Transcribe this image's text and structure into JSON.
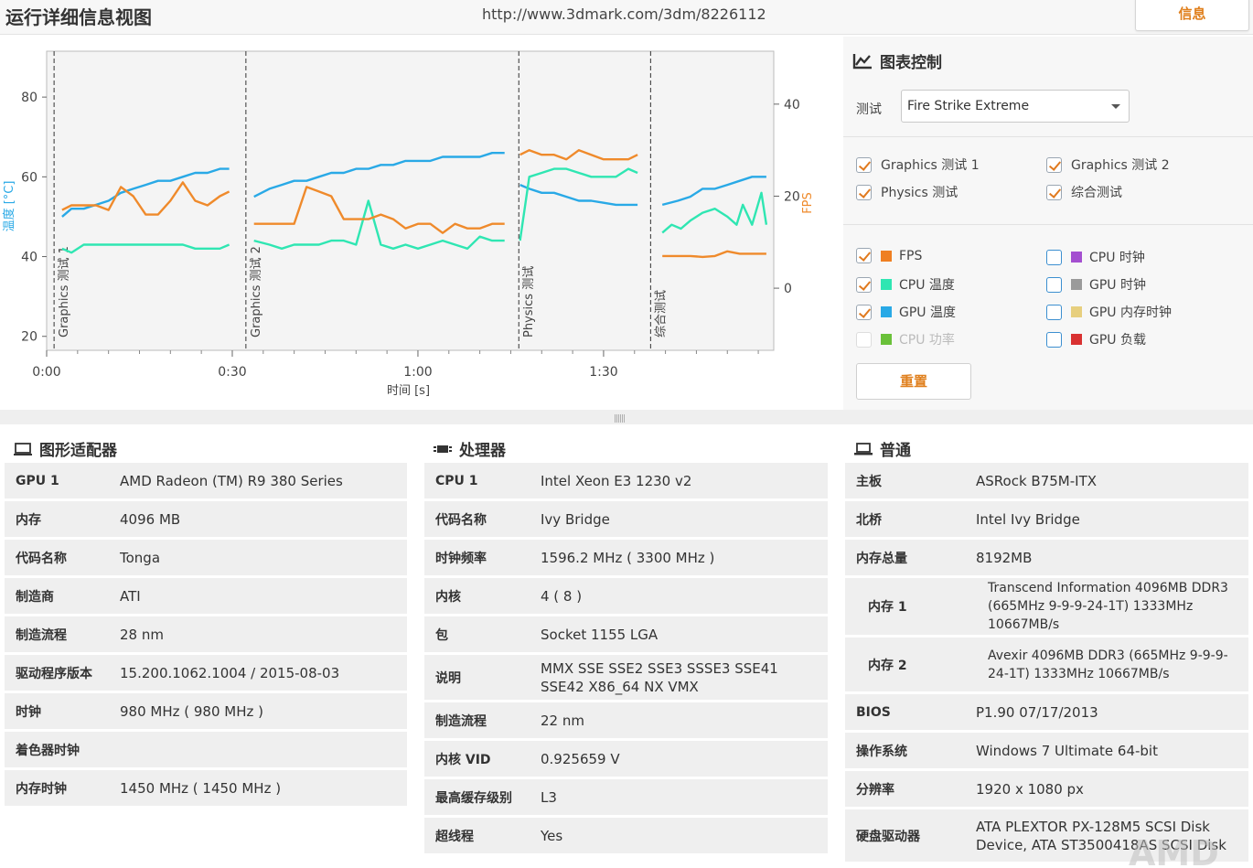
{
  "header": {
    "title": "运行详细信息视图",
    "url": "http://www.3dmark.com/3dm/8226112",
    "info_button": "信息"
  },
  "chart_data": {
    "type": "line",
    "xlabel": "时间 [s]",
    "ylabel_left": "温度 [°C]",
    "ylabel_right": "FPS",
    "x_ticks": [
      "0:00",
      "0:30",
      "1:00",
      "1:30"
    ],
    "x_tick_values": [
      0,
      30,
      60,
      90
    ],
    "y_left_ticks": [
      "20",
      "40",
      "60",
      "80"
    ],
    "y_left_tick_values": [
      20,
      40,
      60,
      80
    ],
    "y_right_ticks": [
      "0",
      "20",
      "40"
    ],
    "y_right_tick_values": [
      0,
      20,
      40
    ],
    "xlim": [
      0,
      117.5
    ],
    "ylim_left": [
      16.5,
      91.5
    ],
    "ylim_right": [
      -13.5,
      51.5
    ],
    "grid": false,
    "sections": [
      {
        "label": "Graphics 测试 1",
        "start": 1.2
      },
      {
        "label": "Graphics 测试 2",
        "start": 32.2
      },
      {
        "label": "Physics 测试",
        "start": 76.3
      },
      {
        "label": "综合测试",
        "start": 97.6
      }
    ],
    "series": [
      {
        "name": "GPU 温度",
        "axis": "left",
        "color": "#29a9e6",
        "segments": [
          {
            "x": [
              2.5,
              4,
              6,
              8,
              10,
              12,
              14,
              16,
              18,
              20,
              22,
              24,
              26,
              28,
              29.5
            ],
            "y": [
              50,
              52,
              52,
              53,
              54,
              56,
              57,
              58,
              59,
              59,
              60,
              61,
              61,
              62,
              62
            ]
          },
          {
            "x": [
              33.5,
              36,
              38,
              40,
              42,
              44,
              46,
              48,
              50,
              52,
              54,
              56,
              58,
              60,
              62,
              64,
              66,
              68,
              70,
              72,
              74
            ],
            "y": [
              55,
              57,
              58,
              59,
              59,
              60,
              61,
              61,
              62,
              62,
              63,
              63,
              64,
              64,
              64,
              65,
              65,
              65,
              65,
              66,
              66
            ]
          },
          {
            "x": [
              76.5,
              78,
              80,
              82,
              84,
              86,
              88,
              90,
              92,
              94,
              95.5
            ],
            "y": [
              58,
              57,
              56,
              56,
              55,
              54,
              54,
              53.5,
              53,
              53,
              53
            ]
          },
          {
            "x": [
              99.5,
              102,
              104,
              106,
              108,
              110,
              112,
              114,
              116.3
            ],
            "y": [
              53,
              54,
              55,
              57,
              57,
              58,
              59,
              60,
              60
            ]
          }
        ]
      },
      {
        "name": "CPU 温度",
        "axis": "left",
        "color": "#2fe6b2",
        "segments": [
          {
            "x": [
              2.5,
              4,
              6,
              8,
              10,
              12,
              14,
              16,
              18,
              20,
              22,
              24,
              26,
              28,
              29.5
            ],
            "y": [
              42,
              41,
              43,
              43,
              43,
              43,
              43,
              43,
              43,
              43,
              43,
              42,
              42,
              42,
              43
            ]
          },
          {
            "x": [
              33.5,
              36,
              38,
              40,
              42,
              44,
              46,
              48,
              50,
              52,
              54,
              56,
              58,
              60,
              62,
              64,
              66,
              68,
              70,
              72,
              74
            ],
            "y": [
              44,
              43,
              42,
              43,
              43,
              43,
              44,
              44,
              43,
              54,
              43,
              42,
              43,
              42,
              43,
              44,
              43,
              42,
              45,
              44,
              44
            ]
          },
          {
            "x": [
              76.5,
              78,
              80,
              82,
              84,
              86,
              88,
              90,
              92,
              94,
              95.5
            ],
            "y": [
              44,
              60,
              61,
              62,
              62,
              61,
              60,
              60,
              60,
              62,
              61
            ]
          },
          {
            "x": [
              99.5,
              101,
              102.5,
              104,
              106,
              108,
              110,
              111.5,
              112.5,
              114,
              115.5,
              116.3
            ],
            "y": [
              46,
              48,
              47,
              49,
              51,
              52,
              50,
              48,
              53,
              48,
              56,
              48
            ]
          }
        ]
      },
      {
        "name": "FPS",
        "axis": "right",
        "color": "#ef8a2b",
        "segments": [
          {
            "x": [
              2.5,
              4,
              6,
              8,
              10,
              12,
              14,
              16,
              18,
              20,
              22,
              24,
              26,
              28,
              29.5
            ],
            "y": [
              17,
              18,
              18,
              18,
              17,
              22,
              20,
              16,
              16,
              19,
              23,
              19,
              18,
              20,
              21
            ]
          },
          {
            "x": [
              33.5,
              36,
              38,
              40,
              42,
              44,
              46,
              48,
              50,
              52,
              54,
              56,
              58,
              60,
              62,
              64,
              66,
              68,
              70,
              72,
              74
            ],
            "y": [
              14,
              14,
              14,
              14,
              22,
              21,
              20,
              15,
              15,
              15,
              16,
              15,
              13,
              14,
              14,
              12,
              14,
              13,
              13,
              14,
              14
            ]
          },
          {
            "x": [
              76.5,
              78,
              80,
              82,
              84,
              86,
              88,
              90,
              92,
              94,
              95.5
            ],
            "y": [
              29,
              30,
              29,
              29,
              28,
              30,
              29,
              28,
              28,
              28,
              29
            ]
          },
          {
            "x": [
              99.5,
              102,
              104,
              106,
              108,
              110,
              112,
              114,
              116.3
            ],
            "y": [
              7,
              7,
              7,
              6.8,
              7,
              8,
              7.5,
              7.5,
              7.5
            ]
          }
        ]
      }
    ]
  },
  "chart_control": {
    "title": "图表控制",
    "test_label": "测试",
    "test_selected": "Fire Strike Extreme",
    "tests": [
      {
        "label": "Graphics 测试 1",
        "checked": true
      },
      {
        "label": "Graphics 测试 2",
        "checked": true
      },
      {
        "label": "Physics 测试",
        "checked": true
      },
      {
        "label": "综合测试",
        "checked": true
      }
    ],
    "metrics": [
      {
        "label": "FPS",
        "checked": true,
        "color": "#ef7f22",
        "disabled": false
      },
      {
        "label": "CPU 时钟",
        "checked": false,
        "color": "#a44fd0",
        "disabled": false
      },
      {
        "label": "CPU 温度",
        "checked": true,
        "color": "#2fe6b2",
        "disabled": false
      },
      {
        "label": "GPU 时钟",
        "checked": false,
        "color": "#9a9a9a",
        "disabled": false
      },
      {
        "label": "GPU 温度",
        "checked": true,
        "color": "#29a9e6",
        "disabled": false
      },
      {
        "label": "GPU 内存时钟",
        "checked": false,
        "color": "#e7cf7e",
        "disabled": false
      },
      {
        "label": "CPU 功率",
        "checked": false,
        "color": "#6ac13a",
        "disabled": true
      },
      {
        "label": "GPU 负载",
        "checked": false,
        "color": "#d93131",
        "disabled": false
      }
    ],
    "reset_button": "重置"
  },
  "gpu_panel": {
    "title": "图形适配器",
    "rows": [
      {
        "k": "GPU 1",
        "v": "AMD Radeon (TM) R9 380 Series"
      },
      {
        "k": "内存",
        "v": "4096 MB"
      },
      {
        "k": "代码名称",
        "v": "Tonga"
      },
      {
        "k": "制造商",
        "v": "ATI"
      },
      {
        "k": "制造流程",
        "v": "28 nm"
      },
      {
        "k": "驱动程序版本",
        "v": "15.200.1062.1004 / 2015-08-03"
      },
      {
        "k": "时钟",
        "v": "980 MHz ( 980 MHz )"
      },
      {
        "k": "着色器时钟",
        "v": ""
      },
      {
        "k": "内存时钟",
        "v": "1450 MHz ( 1450 MHz )"
      }
    ]
  },
  "cpu_panel": {
    "title": "处理器",
    "rows": [
      {
        "k": "CPU 1",
        "v": "Intel Xeon E3 1230 v2"
      },
      {
        "k": "代码名称",
        "v": "Ivy Bridge"
      },
      {
        "k": "时钟频率",
        "v": "1596.2 MHz ( 3300 MHz )"
      },
      {
        "k": "内核",
        "v": "4 ( 8 )"
      },
      {
        "k": "包",
        "v": "Socket 1155 LGA"
      },
      {
        "k": "说明",
        "v": "MMX SSE SSE2 SSE3 SSSE3 SSE41 SSE42 X86_64 NX VMX"
      },
      {
        "k": "制造流程",
        "v": "22 nm"
      },
      {
        "k": "内核 VID",
        "v": "0.925659 V"
      },
      {
        "k": "最高缓存级别",
        "v": "L3"
      },
      {
        "k": "超线程",
        "v": "Yes"
      }
    ]
  },
  "general_panel": {
    "title": "普通",
    "rows": [
      {
        "k": "主板",
        "v": "ASRock B75M-ITX"
      },
      {
        "k": "北桥",
        "v": "Intel Ivy Bridge"
      },
      {
        "k": "内存总量",
        "v": "8192MB"
      },
      {
        "k": "内存 1",
        "v": "Transcend Information 4096MB  DDR3 (665MHz 9-9-9-24-1T) 1333MHz 10667MB/s"
      },
      {
        "k": "内存 2",
        "v": "Avexir 4096MB  DDR3 (665MHz 9-9-9-24-1T) 1333MHz 10667MB/s"
      },
      {
        "k": "BIOS",
        "v": "P1.90 07/17/2013"
      },
      {
        "k": "操作系统",
        "v": "Windows 7 Ultimate 64-bit"
      },
      {
        "k": "分辨率",
        "v": "1920 x 1080 px"
      },
      {
        "k": "硬盘驱动器",
        "v": "ATA PLEXTOR PX-128M5 SCSI Disk Device, ATA ST3500418AS SCSI Disk"
      }
    ]
  },
  "watermark": "AMD"
}
